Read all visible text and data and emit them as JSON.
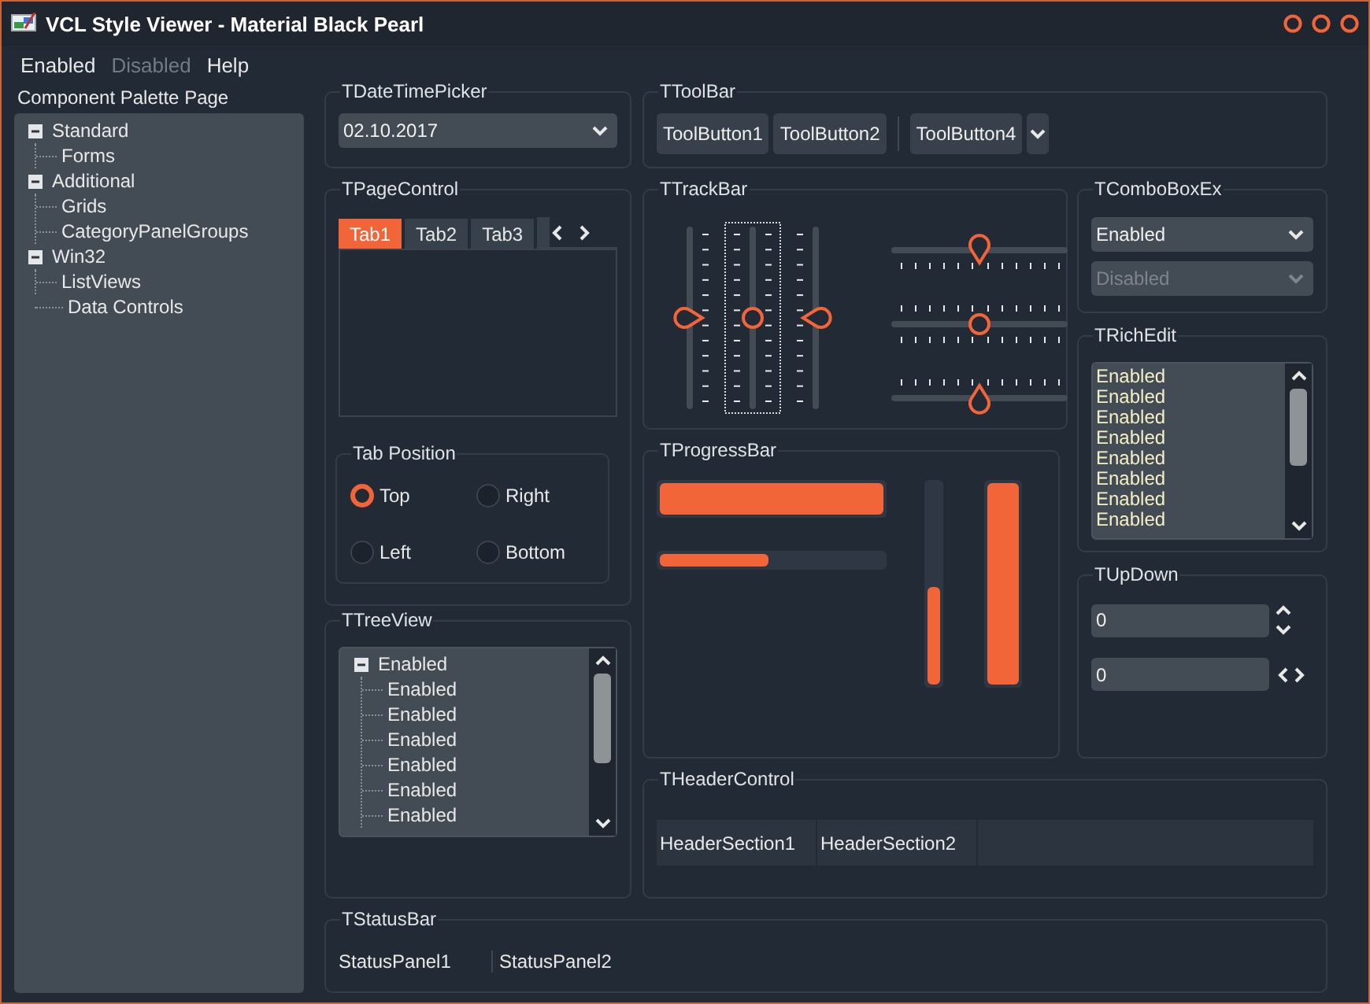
{
  "window": {
    "title": "VCL Style Viewer - Material Black Pearl"
  },
  "menu": [
    {
      "label": "Enabled",
      "disabled": false
    },
    {
      "label": "Disabled",
      "disabled": true
    },
    {
      "label": "Help",
      "disabled": false
    }
  ],
  "sidebar": {
    "title": "Component Palette Page",
    "tree": [
      {
        "label": "Standard",
        "expanded": true,
        "children": [
          {
            "label": "Forms"
          }
        ]
      },
      {
        "label": "Additional",
        "expanded": true,
        "children": [
          {
            "label": "Grids"
          },
          {
            "label": "CategoryPanelGroups"
          }
        ]
      },
      {
        "label": "Win32",
        "expanded": true,
        "children": [
          {
            "label": "ListViews"
          }
        ]
      },
      {
        "label": "Data Controls"
      }
    ]
  },
  "date_time_picker": {
    "title": "TDateTimePicker",
    "value": "02.10.2017"
  },
  "toolbar": {
    "title": "TToolBar",
    "items": [
      {
        "kind": "button",
        "label": "ToolButton1"
      },
      {
        "kind": "button",
        "label": "ToolButton2"
      },
      {
        "kind": "separator"
      },
      {
        "kind": "button",
        "label": "ToolButton4"
      },
      {
        "kind": "dropdown"
      }
    ]
  },
  "page_control": {
    "title": "TPageControl",
    "tabs": [
      {
        "label": "Tab1",
        "selected": true
      },
      {
        "label": "Tab2",
        "selected": false
      },
      {
        "label": "Tab3",
        "selected": false
      }
    ]
  },
  "tab_position": {
    "title": "Tab Position",
    "options": [
      {
        "label": "Top",
        "selected": true
      },
      {
        "label": "Right",
        "selected": false
      },
      {
        "label": "Left",
        "selected": false
      },
      {
        "label": "Bottom",
        "selected": false
      }
    ]
  },
  "tree_view": {
    "title": "TTreeView",
    "items": [
      {
        "label": "Enabled",
        "expanded": true,
        "children": [
          {
            "label": "Enabled"
          },
          {
            "label": "Enabled"
          },
          {
            "label": "Enabled"
          },
          {
            "label": "Enabled"
          },
          {
            "label": "Enabled"
          },
          {
            "label": "Enabled"
          }
        ]
      }
    ]
  },
  "trackbar": {
    "title": "TTrackBar",
    "vertical": [
      {
        "kind": "after",
        "level": 0.5,
        "focused": false
      },
      {
        "kind": "both",
        "level": 0.5,
        "focused": true
      },
      {
        "kind": "before",
        "level": 0.5,
        "focused": false
      }
    ],
    "horizontal": [
      {
        "kind": "after",
        "level": 0.5
      },
      {
        "kind": "both",
        "level": 0.5
      },
      {
        "kind": "before",
        "level": 0.5
      }
    ]
  },
  "combo_box_ex": {
    "title": "TComboBoxEx",
    "items": [
      {
        "value": "Enabled",
        "disabled": false
      },
      {
        "value": "Disabled",
        "disabled": true
      }
    ]
  },
  "rich_edit": {
    "title": "TRichEdit",
    "lines": [
      "Enabled",
      "Enabled",
      "Enabled",
      "Enabled",
      "Enabled",
      "Enabled",
      "Enabled",
      "Enabled"
    ]
  },
  "progress_bar": {
    "title": "TProgressBar",
    "bars": [
      {
        "kind": "wide",
        "level": 1.0
      },
      {
        "kind": "narrow",
        "level": 0.5
      },
      {
        "kind": "slim",
        "level": 0.5
      },
      {
        "kind": "tall",
        "level": 1.0
      }
    ]
  },
  "up_down": {
    "title": "TUpDown",
    "fields": [
      {
        "value": "0",
        "kind": "updown"
      },
      {
        "value": "0",
        "kind": "leftright"
      }
    ]
  },
  "header_control": {
    "title": "THeaderControl",
    "sections": [
      "HeaderSection1",
      "HeaderSection2"
    ]
  },
  "status_bar": {
    "title": "TStatusBar",
    "panels": [
      "StatusPanel1",
      "StatusPanel2"
    ]
  }
}
